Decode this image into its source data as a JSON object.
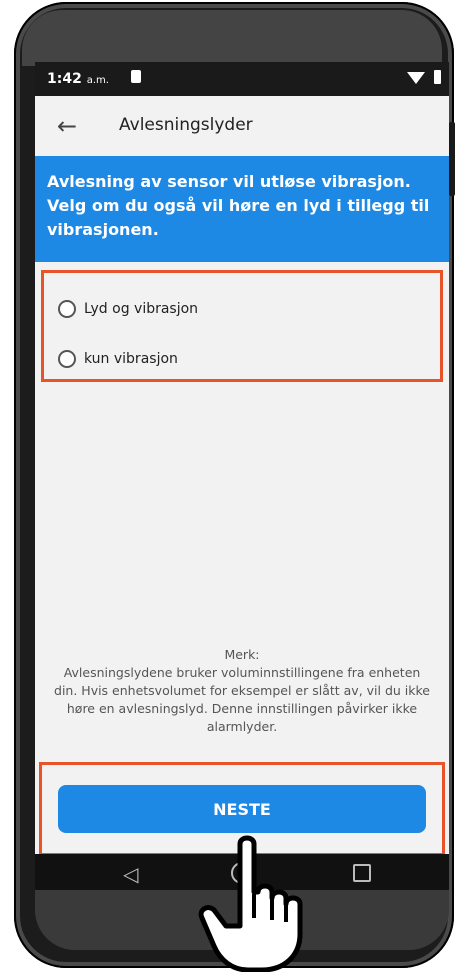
{
  "status_bar": {
    "time": "1:42",
    "ampm": "a.m."
  },
  "app_bar": {
    "back_icon": "arrow-left-icon",
    "title": "Avlesningslyder"
  },
  "banner": {
    "text": "Avlesning av sensor vil utløse vibrasjon. Velg om du også vil høre en lyd i tillegg til vibrasjonen."
  },
  "options": [
    {
      "label": "Lyd og vibrasjon",
      "selected": false
    },
    {
      "label": "kun vibrasjon",
      "selected": false
    }
  ],
  "note": {
    "title": "Merk:",
    "body": "Avlesningslydene bruker voluminnstillingene fra enheten din. Hvis enhetsvolumet for eksempel er slått av, vil du ikke høre en avlesningslyd. Denne innstillingen påvirker ikke alarmlyder."
  },
  "footer": {
    "next_label": "NESTE"
  },
  "colors": {
    "accent": "#1e88e5",
    "highlight": "#e8542a"
  }
}
